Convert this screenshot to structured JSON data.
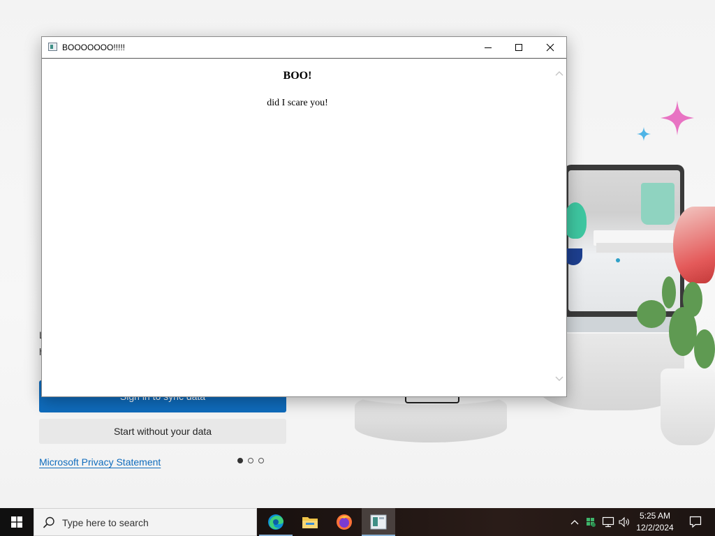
{
  "popup": {
    "title": "BOOOOOOO!!!!!",
    "heading": "BOO!",
    "message": "did I scare you!"
  },
  "edge_page": {
    "sync_button_label": "Sign in to sync data",
    "start_button_label": "Start without your data",
    "privacy_link": "Microsoft Privacy Statement",
    "carousel": {
      "total": 3,
      "active": 1
    }
  },
  "taskbar": {
    "search_placeholder": "Type here to search",
    "time": "5:25 AM",
    "date": "12/2/2024",
    "pinned_apps": [
      "edge-icon",
      "file-explorer-icon",
      "firefox-icon",
      "popup-app-icon"
    ],
    "tray_icons": [
      "chevron-up-icon",
      "network-icon",
      "speaker-icon",
      "notification-icon"
    ]
  },
  "colors": {
    "accent_blue": "#0f6cbd",
    "secondary_button": "#e8e8e8",
    "taskbar_bg": "#101010"
  }
}
